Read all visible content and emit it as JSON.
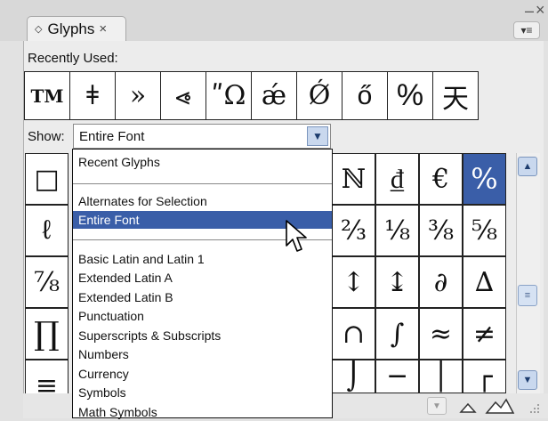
{
  "window": {
    "minimize_glyph": "–",
    "close_glyph": "×"
  },
  "panel": {
    "tab_title": "Glyphs",
    "tab_icon": "◇",
    "tab_close": "×",
    "menu_glyph": "▾≡"
  },
  "recent": {
    "label": "Recently Used:",
    "glyphs": [
      "TM",
      "ǂ",
      "»",
      "⩹",
      "ʺΩ",
      "ǽ",
      "Ǿ",
      "ő",
      "%",
      "天"
    ]
  },
  "show": {
    "label": "Show:",
    "value": "Entire Font",
    "options": [
      "Recent Glyphs",
      "Alternates for Selection",
      "Entire Font",
      "Basic Latin and Latin 1",
      "Extended Latin A",
      "Extended Latin B",
      "Punctuation",
      "Superscripts & Subscripts",
      "Numbers",
      "Currency",
      "Symbols",
      "Math Symbols"
    ],
    "highlighted": "Entire Font"
  },
  "grid": {
    "left_col": [
      "□",
      "ℓ",
      "⅞",
      "∏",
      "≡"
    ],
    "right_rows": [
      [
        "ℕ",
        "₫",
        "€",
        "%"
      ],
      [
        "⅔",
        "⅛",
        "⅜",
        "⅝"
      ],
      [
        "↕",
        "↨",
        "∂",
        "∆"
      ],
      [
        "∩",
        "∫",
        "≈",
        "≠"
      ],
      [
        "⌡",
        "─",
        "│",
        "┌"
      ]
    ],
    "selected_glyph": "%"
  },
  "scrollbar": {
    "up_glyph": "▲",
    "down_glyph": "▼",
    "thumb_glyph": "≡"
  },
  "icons": {
    "tab_icon": "diamond-icon",
    "cursor": "pointer-cursor-icon",
    "zoom_out": "small-mountain-icon",
    "zoom_in": "large-mountain-icon",
    "grip": "resize-grip-icon"
  },
  "colors": {
    "selection": "#3a5ea8",
    "accent_button": "#c9d8ee"
  }
}
